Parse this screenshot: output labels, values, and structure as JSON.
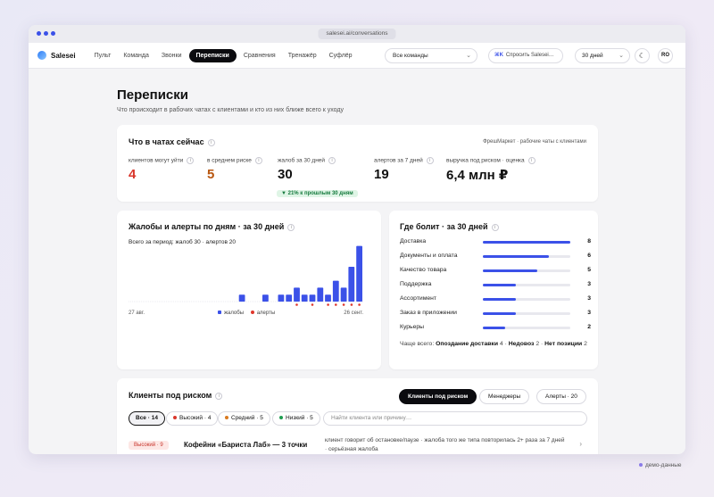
{
  "browser": {
    "url": "salesei.ai/conversations"
  },
  "nav": {
    "brand": "Salesei",
    "items": [
      "Пульт",
      "Команда",
      "Звонки",
      "Переписки",
      "Сравнения",
      "Тренажёр",
      "Суфлёр"
    ],
    "active": "Переписки",
    "team_select": "Все команды",
    "ask_shortcut": "⌘K",
    "ask_label": "Спросить Salesei…",
    "period": "30 дней",
    "avatar": "RO"
  },
  "page": {
    "title": "Переписки",
    "subtitle": "Что происходит в рабочих чатах с клиентами и кто из них ближе всего к уходу"
  },
  "summary": {
    "title": "Что в чатах сейчас",
    "context": "ФрешМаркет · рабочие чаты с клиентами",
    "kpis": [
      {
        "label": "клиентов могут уйти",
        "value": "4",
        "color": "#d9362b"
      },
      {
        "label": "в среднем риске",
        "value": "5",
        "color": "#b8560f"
      },
      {
        "label": "жалоб за 30 дней",
        "value": "30",
        "color": "#111111"
      },
      {
        "label": "алертов за 7 дней",
        "value": "19",
        "color": "#111111"
      },
      {
        "label": "выручка под риском · оценка",
        "value": "6,4 млн ₽",
        "color": "#111111"
      }
    ],
    "delta": "▼ 21% к прошлым 30 дням"
  },
  "daily": {
    "title": "Жалобы и алерты по дням · за 30 дней",
    "total": "Всего за период: жалоб 30 · алертов 20",
    "date_start": "27 авг.",
    "date_end": "26 сент.",
    "legend_complaints": "жалобы",
    "legend_alerts": "алерты",
    "colors": {
      "complaints": "#3b51e8",
      "alerts": "#e0362b"
    }
  },
  "chart_data": {
    "type": "bar",
    "x_start": "27 авг.",
    "x_end": "26 сент.",
    "series": [
      {
        "name": "жалобы",
        "values": [
          0,
          0,
          0,
          0,
          0,
          0,
          0,
          0,
          0,
          0,
          0,
          0,
          0,
          0,
          1,
          0,
          0,
          1,
          0,
          1,
          1,
          2,
          1,
          1,
          2,
          1,
          3,
          2,
          5,
          8
        ]
      },
      {
        "name": "алерты",
        "values": [
          0,
          0,
          0,
          0,
          0,
          0,
          0,
          0,
          0,
          0,
          0,
          0,
          0,
          0,
          0,
          0,
          0,
          0,
          0,
          0,
          0,
          1,
          0,
          1,
          0,
          1,
          1,
          1,
          1,
          1
        ]
      }
    ]
  },
  "pain": {
    "title": "Где болит · за 30 дней",
    "max": 8,
    "items": [
      {
        "label": "Доставка",
        "count": 8
      },
      {
        "label": "Документы и оплата",
        "count": 6
      },
      {
        "label": "Качество товара",
        "count": 5
      },
      {
        "label": "Поддержка",
        "count": 3
      },
      {
        "label": "Ассортимент",
        "count": 3
      },
      {
        "label": "Заказ в приложении",
        "count": 3
      },
      {
        "label": "Курьеры",
        "count": 2
      }
    ],
    "often_label": "Чаще всего: ",
    "often_items": [
      {
        "name": "Опоздание доставки",
        "count": "4"
      },
      {
        "name": "Недовоз",
        "count": "2"
      },
      {
        "name": "Нет позиции",
        "count": "2"
      }
    ]
  },
  "clients": {
    "title": "Клиенты под риском",
    "tabs": [
      "Клиенты под риском",
      "Менеджеры",
      "Алерты · 20"
    ],
    "filters": [
      {
        "label": "Все · 14",
        "dot": ""
      },
      {
        "label": "Высокий · 4",
        "dot": "#d9362b"
      },
      {
        "label": "Средний · 5",
        "dot": "#d97a1f"
      },
      {
        "label": "Низкий · 5",
        "dot": "#1f9d50"
      }
    ],
    "search_placeholder": "Найти клиента или причину…",
    "rows": [
      {
        "risk": "Высокий · 9",
        "name": "Кофейни «Бариста Лаб» — 3 точки",
        "reason": "клиент говорит об остановке/паузе · жалоба того же типа повторилась 2+ раза за 7 дней · серьёзная жалоба"
      }
    ]
  },
  "footer": {
    "demo": "демо-данные"
  }
}
